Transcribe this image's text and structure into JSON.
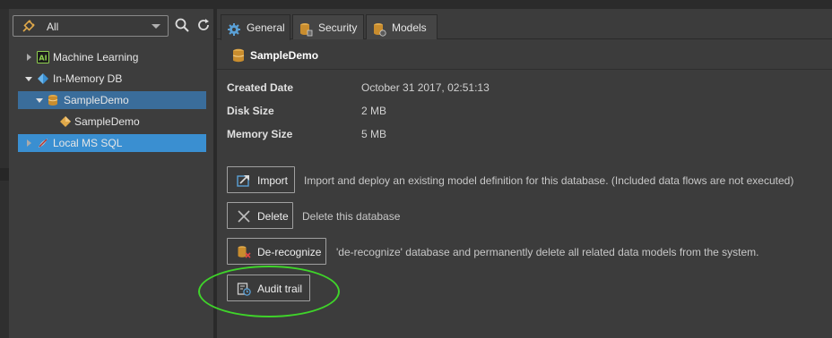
{
  "filter": {
    "selected": "All"
  },
  "tree": {
    "items": [
      {
        "label": "Machine Learning"
      },
      {
        "label": "In-Memory DB"
      },
      {
        "label": "SampleDemo"
      },
      {
        "label": "SampleDemo"
      },
      {
        "label": "Local MS SQL"
      }
    ]
  },
  "tabs": [
    {
      "label": "General"
    },
    {
      "label": "Security"
    },
    {
      "label": "Models"
    }
  ],
  "header": {
    "title": "SampleDemo"
  },
  "properties": [
    {
      "label": "Created Date",
      "value": "October 31 2017, 02:51:13"
    },
    {
      "label": "Disk Size",
      "value": "2 MB"
    },
    {
      "label": "Memory Size",
      "value": "5 MB"
    }
  ],
  "actions": [
    {
      "label": "Import",
      "description": "Import and deploy an existing model definition for this database. (Included data flows are not executed)"
    },
    {
      "label": "Delete",
      "description": "Delete this database"
    },
    {
      "label": "De-recognize",
      "description": "'de-recognize' database and permanently delete all related data models from the system."
    },
    {
      "label": "Audit trail",
      "description": ""
    }
  ],
  "colors": {
    "selected_row": "#3a6d9b",
    "active_row": "#3a8fd1",
    "highlight_ring": "#3fd42a",
    "database_icon": "#e0a94a"
  },
  "icons": [
    "plugin-icon",
    "search-icon",
    "refresh-icon",
    "ai-icon",
    "inmemory-icon",
    "database-icon",
    "model-icon",
    "mssql-icon",
    "gear-icon",
    "shield-database-icon",
    "models-database-icon",
    "import-icon",
    "delete-icon",
    "derecognize-icon",
    "audit-trail-icon"
  ]
}
